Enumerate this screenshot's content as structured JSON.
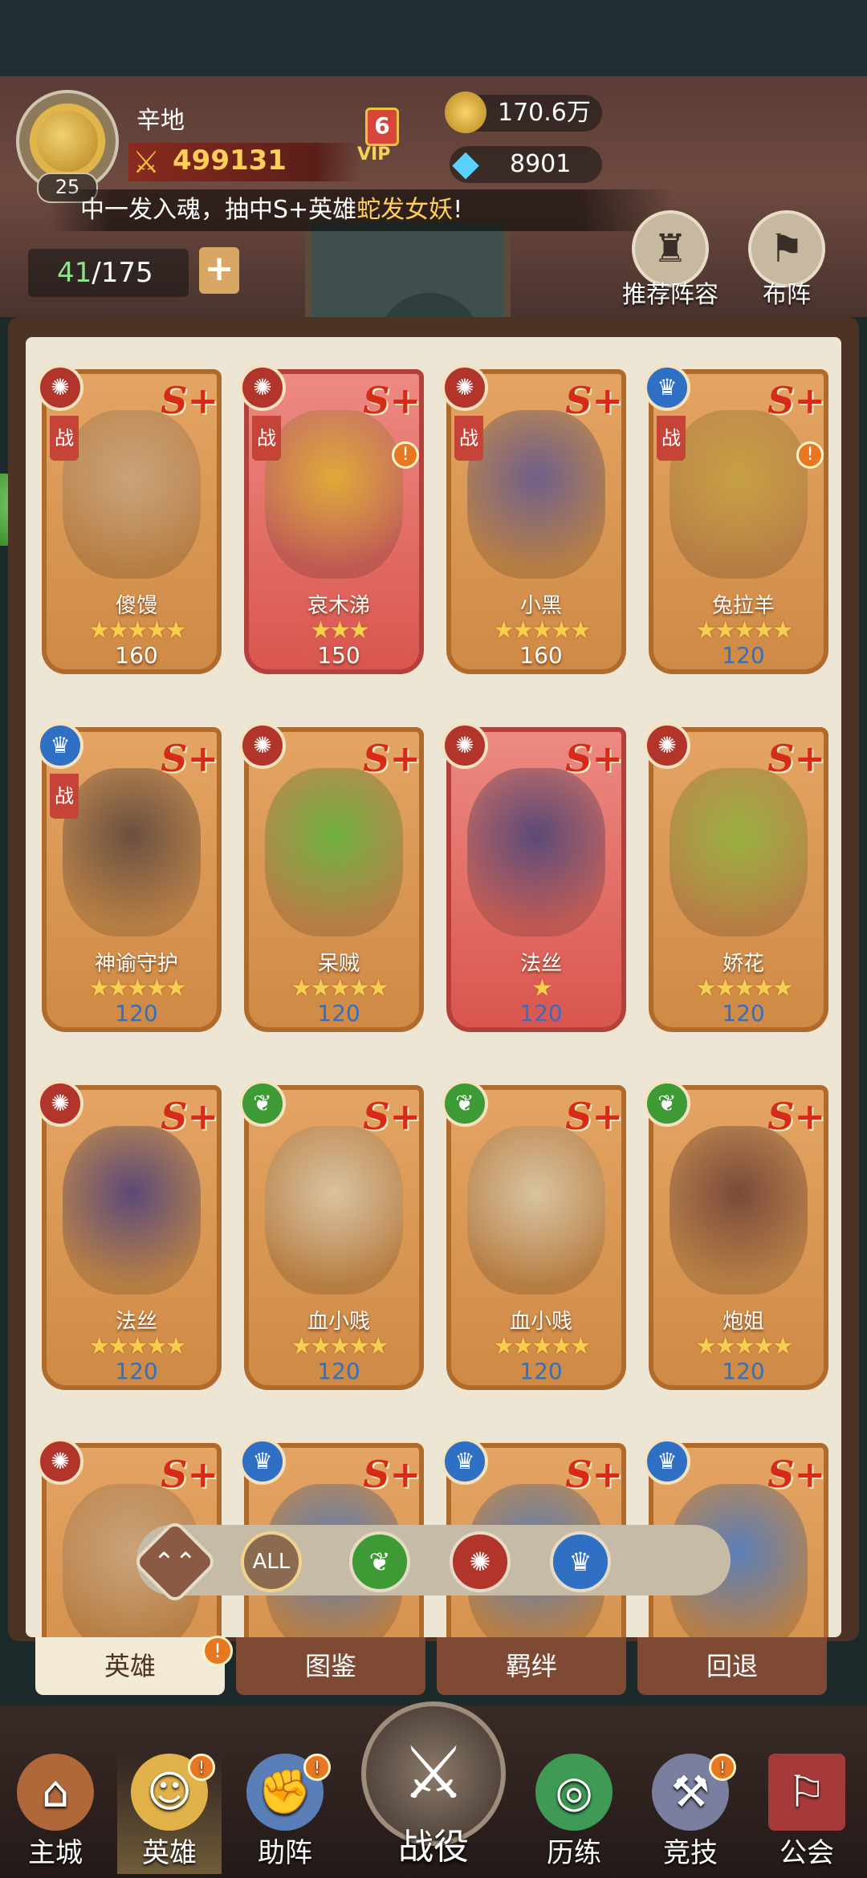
{
  "player": {
    "name": "辛地",
    "level": "25",
    "power": "499131",
    "vip_level": "6",
    "vip_label": "VIP"
  },
  "currency": {
    "gold": "170.6万",
    "gems": "8901"
  },
  "marquee": {
    "prefix": "中一发入魂，抽中S+英雄",
    "highlight": "蛇发女妖",
    "suffix": "!"
  },
  "hero_count": {
    "owned": "41",
    "separator_total": "/175",
    "add_label": "+"
  },
  "header_buttons": {
    "recommend": "推荐阵容",
    "formation": "布阵"
  },
  "role_label": "战",
  "heroes": [
    {
      "name": "傻馒",
      "level": "160",
      "rank": "S+",
      "faction": "horde",
      "stars": 5,
      "role": true,
      "badge": false,
      "red": false
    },
    {
      "name": "哀木涕",
      "level": "150",
      "rank": "S+",
      "faction": "horde",
      "stars": 3,
      "role": true,
      "badge": true,
      "red": true
    },
    {
      "name": "小黑",
      "level": "160",
      "rank": "S+",
      "faction": "horde",
      "stars": 5,
      "role": true,
      "badge": false,
      "red": false
    },
    {
      "name": "兔拉羊",
      "level": "120",
      "rank": "S+",
      "faction": "alliance",
      "stars": 5,
      "role": true,
      "badge": true,
      "red": false
    },
    {
      "name": "神谕守护",
      "level": "120",
      "rank": "S+",
      "faction": "alliance",
      "stars": 5,
      "role": true,
      "badge": false,
      "red": false
    },
    {
      "name": "呆贼",
      "level": "120",
      "rank": "S+",
      "faction": "horde",
      "stars": 5,
      "role": false,
      "badge": false,
      "red": false
    },
    {
      "name": "法丝",
      "level": "120",
      "rank": "S+",
      "faction": "horde",
      "stars": 1,
      "role": false,
      "badge": false,
      "red": true
    },
    {
      "name": "娇花",
      "level": "120",
      "rank": "S+",
      "faction": "horde",
      "stars": 5,
      "role": false,
      "badge": false,
      "red": false
    },
    {
      "name": "法丝",
      "level": "120",
      "rank": "S+",
      "faction": "horde",
      "stars": 5,
      "role": false,
      "badge": false,
      "red": false
    },
    {
      "name": "血小贱",
      "level": "120",
      "rank": "S+",
      "faction": "nature",
      "stars": 5,
      "role": false,
      "badge": false,
      "red": false
    },
    {
      "name": "血小贱",
      "level": "120",
      "rank": "S+",
      "faction": "nature",
      "stars": 5,
      "role": false,
      "badge": false,
      "red": false
    },
    {
      "name": "炮姐",
      "level": "120",
      "rank": "S+",
      "faction": "nature",
      "stars": 5,
      "role": false,
      "badge": false,
      "red": false
    },
    {
      "name": "",
      "level": "",
      "rank": "S+",
      "faction": "horde",
      "stars": 0,
      "role": false,
      "badge": false,
      "red": false
    },
    {
      "name": "",
      "level": "",
      "rank": "S+",
      "faction": "alliance",
      "stars": 0,
      "role": false,
      "badge": false,
      "red": false
    },
    {
      "name": "",
      "level": "",
      "rank": "S+",
      "faction": "alliance",
      "stars": 0,
      "role": false,
      "badge": false,
      "red": false
    },
    {
      "name": "",
      "level": "",
      "rank": "S+",
      "faction": "alliance",
      "stars": 0,
      "role": false,
      "badge": false,
      "red": false
    }
  ],
  "filters": {
    "collapse": "⌃⌃",
    "all": "ALL"
  },
  "tabs": [
    "英雄",
    "图鉴",
    "羁绊",
    "回退"
  ],
  "nav": {
    "main_city": "主城",
    "heroes": "英雄",
    "assist": "助阵",
    "battle": "战役",
    "training": "历练",
    "arena": "竞技",
    "guild": "公会"
  },
  "badge_symbol": "!",
  "colors": {
    "card_orange": "#d9934d",
    "card_red": "#d9564f",
    "horde": "#b2352b",
    "alliance": "#2f6fc4",
    "nature": "#3e9a35",
    "panel": "#eee6d4"
  }
}
